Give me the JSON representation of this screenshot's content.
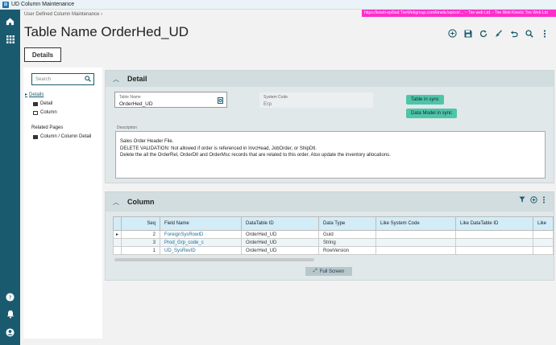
{
  "window": {
    "title": "UD Column Maintenance"
  },
  "header": {
    "breadcrumb": "User Defined Column Maintenance",
    "url": "https://kineti-epi9ad.TireWebgroup.com/kinetic/epicor/...  ~ Tire web Ltd.  - Tire Web Kinetic  Tire Web Ltd",
    "title": "Table Name OrderHed_UD"
  },
  "tabs": {
    "details": "Details"
  },
  "nav": {
    "search_placeholder": "Search",
    "details": "Details",
    "detail": "Detail",
    "column": "Column",
    "related_heading": "Related Pages",
    "related_item": "Column / Column Detail"
  },
  "detail": {
    "title": "Detail",
    "table_name_label": "Table Name",
    "table_name_value": "OrderHed_UD",
    "system_code_label": "System Code",
    "system_code_value": "Erp",
    "badge_table": "Table in sync",
    "badge_model": "Data Model in sync",
    "description_label": "Description",
    "description_lines": [
      "Sales Order Header File.",
      "DELETE VALIDATION: Not allowed if order is referenced in InvcHead, JobOrder, or ShipDtl.",
      "Delete the all the OrderRel, OrderDtl and OrderMsc records that are related to this order. Also update the inventory allocations."
    ]
  },
  "column": {
    "title": "Column",
    "headers": [
      "Seq",
      "Field Name",
      "DataTable ID",
      "Data Type",
      "Like System Code",
      "Like DataTable ID",
      "Like"
    ],
    "rows": [
      {
        "seq": "2",
        "field": "ForeignSysRowID",
        "table": "OrderHed_UD",
        "type": "Guid"
      },
      {
        "seq": "3",
        "field": "Prod_Grp_code_c",
        "table": "OrderHed_UD",
        "type": "String"
      },
      {
        "seq": "1",
        "field": "UD_SysRevID",
        "table": "OrderHed_UD",
        "type": "RowVersion"
      }
    ],
    "full_screen": "Full Screen"
  },
  "colors": {
    "rail": "#1a5a6e",
    "badge": "#4fc5a8",
    "grid_header": "#d3ecf7"
  }
}
